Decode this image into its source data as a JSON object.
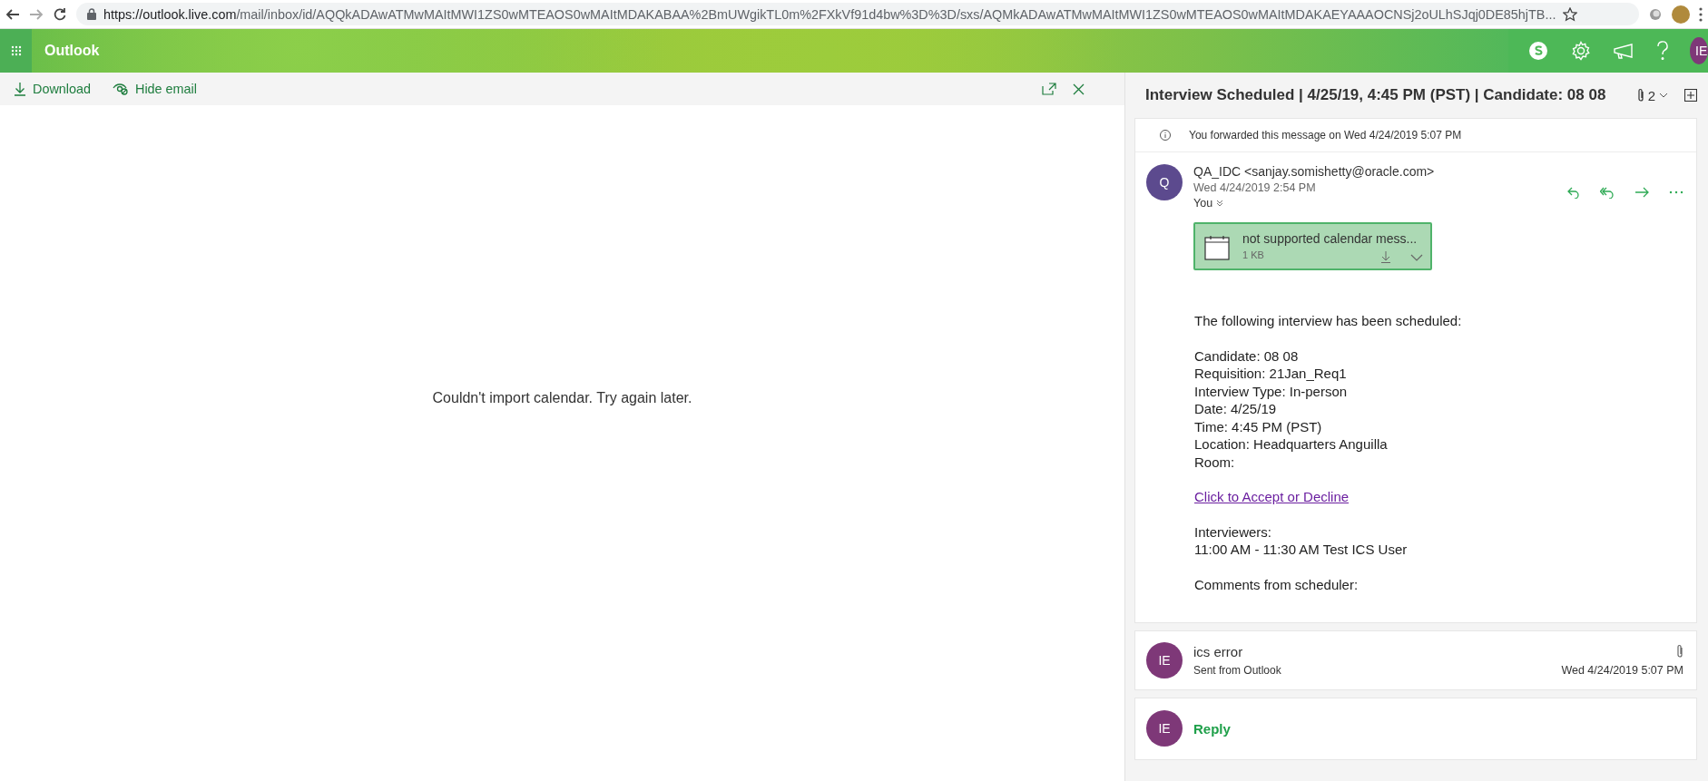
{
  "browser": {
    "url_host": "https://outlook.live.com",
    "url_path": "/mail/inbox/id/AQQkADAwATMwMAItMWI1ZS0wMTEAOS0wMAItMDAKABAA%2BmUWgikTL0m%2FXkVf91d4bw%3D%3D/sxs/AQMkADAwATMwMAItMWI1ZS0wMTEAOS0wMAItMDAKAEYAAAOCNSj2oULhSJqj0DE85hjTB..."
  },
  "header": {
    "app_name": "Outlook",
    "avatar_initials": "IE"
  },
  "toolbar": {
    "actions": [
      {
        "kind": "download",
        "label": "Download"
      },
      {
        "kind": "hide",
        "label": "Hide email"
      }
    ]
  },
  "reader": {
    "message": "Couldn't import calendar. Try again later."
  },
  "conversation": {
    "title": "Interview Scheduled | 4/25/19, 4:45 PM (PST) | Candidate: 08 08",
    "attachment_count": "2",
    "notice": "You forwarded this message on Wed 4/24/2019 5:07 PM",
    "message": {
      "avatar_initial": "Q",
      "sender": "QA_IDC <sanjay.somishetty@oracle.com>",
      "date": "Wed 4/24/2019 2:54 PM",
      "recipients": "You",
      "attachment": {
        "name": "not supported calendar mess...",
        "size": "1 KB"
      },
      "body": [
        {
          "kind": "text",
          "lines": [
            "The following interview has been scheduled:"
          ]
        },
        {
          "kind": "text",
          "lines": [
            "Candidate: 08 08",
            "Requisition: 21Jan_Req1",
            "Interview Type: In-person",
            "Date: 4/25/19",
            "Time: 4:45 PM (PST)",
            "Location: Headquarters Anguilla",
            "Room:"
          ]
        },
        {
          "kind": "link",
          "lines": [
            "Click to Accept or Decline"
          ]
        },
        {
          "kind": "text",
          "lines": [
            "Interviewers:",
            "11:00 AM - 11:30 AM Test ICS User"
          ]
        },
        {
          "kind": "text",
          "lines": [
            "Comments from scheduler:"
          ]
        }
      ]
    },
    "reply_item": {
      "avatar_initials": "IE",
      "subject": "ics error",
      "preview": "Sent from Outlook",
      "date": "Wed 4/24/2019 5:07 PM"
    },
    "reply_box": {
      "avatar_initials": "IE",
      "label": "Reply"
    }
  }
}
